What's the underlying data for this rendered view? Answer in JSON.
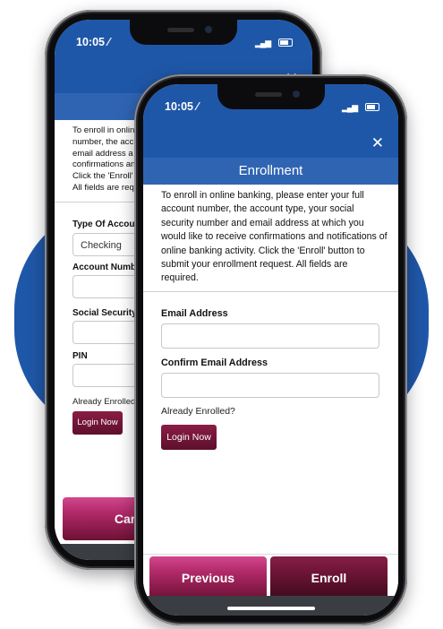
{
  "colors": {
    "header_blue": "#1f57a8",
    "title_blue": "#2f64b3",
    "button_maroon": "#6b1434",
    "button_pink": "#b22a6a"
  },
  "back": {
    "status_time": "10:05 ⁄",
    "close_label": "✕",
    "intro_lines": [
      "To enroll in onlin",
      "number, the acc",
      "email address a",
      "confirmations an",
      "Click the 'Enroll'",
      "All fields are req"
    ],
    "type_label": "Type Of Accou",
    "type_value": "Checking",
    "account_label": "Account Numb",
    "ssn_label": "Social Security",
    "pin_label": "PIN",
    "already_enrolled": "Already Enrolled",
    "login_label": "Login Now",
    "cancel_label": "Canc"
  },
  "front": {
    "status_time": "10:05 ⁄",
    "close_label": "✕",
    "title": "Enrollment",
    "intro_lines": [
      "To enroll in online banking, please enter your full",
      "account number, the account type, your social",
      "security number and email address at which you",
      "would like to receive confirmations and notifications of",
      "online banking activity. Click the 'Enroll' button to",
      "submit your enrollment request. All fields are",
      "required."
    ],
    "email_label": "Email Address",
    "email_value": "",
    "confirm_email_label": "Confirm Email Address",
    "confirm_email_value": "",
    "already_enrolled": "Already Enrolled?",
    "login_label": "Login Now",
    "previous_label": "Previous",
    "enroll_label": "Enroll"
  }
}
